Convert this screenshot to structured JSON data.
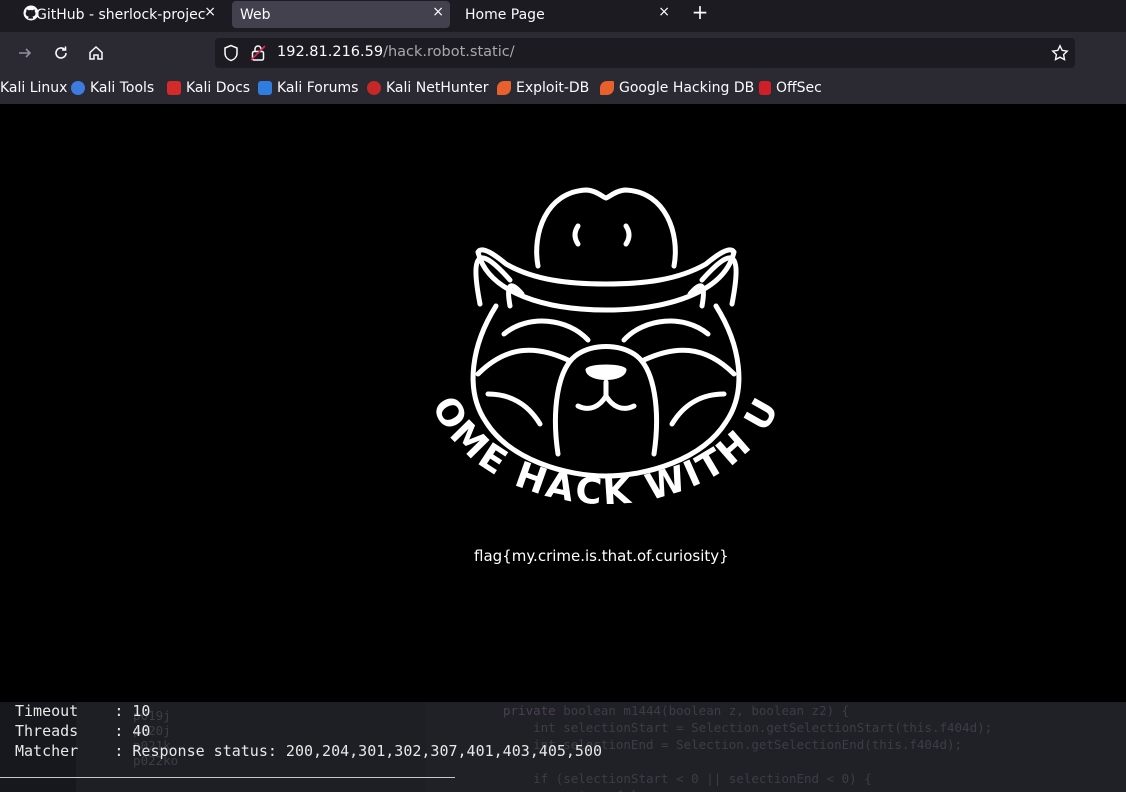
{
  "browser": {
    "tabs": [
      {
        "label": "GitHub - sherlock-project",
        "icon": "github-icon",
        "active": false
      },
      {
        "label": "Web",
        "active": true
      },
      {
        "label": "Home Page",
        "active": false
      }
    ],
    "new_tab": "+",
    "close_glyph": "×",
    "url_host": "192.81.216.59",
    "url_path": "/hack.robot.static/"
  },
  "bookmarks": [
    {
      "label": "Kali Linux"
    },
    {
      "label": "Kali Tools"
    },
    {
      "label": "Kali Docs"
    },
    {
      "label": "Kali Forums"
    },
    {
      "label": "Kali NetHunter"
    },
    {
      "label": "Exploit-DB"
    },
    {
      "label": "Google Hacking DB"
    },
    {
      "label": "OffSec"
    }
  ],
  "page": {
    "logo_text": "COME HACK WITH US",
    "flag": "flag{my.crime.is.that.of.curiosity}"
  },
  "terminal": {
    "lines": [
      {
        "key": "Timeout ",
        "value": ": 10"
      },
      {
        "key": "Threads ",
        "value": ": 40"
      },
      {
        "key": "Matcher ",
        "value": ": Response status: 200,204,301,302,307,401,403,405,500"
      }
    ]
  },
  "colors": {
    "tabbar": "#1c1b22",
    "toolbar": "#2b2a33",
    "active_tab": "#42414d",
    "page_bg": "#000000",
    "terminal_bg": "#16181d"
  }
}
